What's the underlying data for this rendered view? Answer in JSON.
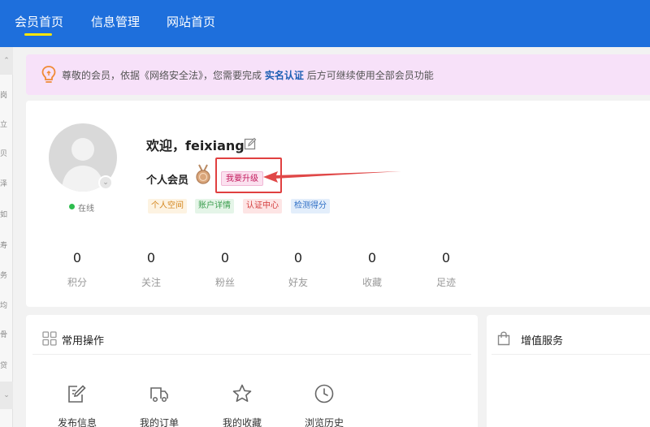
{
  "top_nav": {
    "items": [
      {
        "label": "会员首页",
        "active": true
      },
      {
        "label": "信息管理",
        "active": false
      },
      {
        "label": "网站首页",
        "active": false
      }
    ],
    "accent_color": "#ffe600",
    "background_color": "#1e6fdc"
  },
  "sidebar": {
    "chars": [
      "岗",
      "立",
      "贝",
      "泽",
      "如",
      "寿",
      "务",
      "均",
      "骨",
      "贷"
    ]
  },
  "notice": {
    "prefix": "尊敬的会员，依据《网络安全法》，您需要完成",
    "link": "实名认证",
    "suffix": "后方可继续使用全部会员功能",
    "icon": "lightbulb-icon"
  },
  "profile": {
    "welcome": "欢迎，feixiang",
    "status": "在线",
    "member_level": "个人会员",
    "upgrade_label": "我要升级",
    "tags": [
      "个人空间",
      "账户详情",
      "认证中心",
      "检测得分"
    ],
    "stats": [
      {
        "value": "0",
        "label": "积分"
      },
      {
        "value": "0",
        "label": "关注"
      },
      {
        "value": "0",
        "label": "粉丝"
      },
      {
        "value": "0",
        "label": "好友"
      },
      {
        "value": "0",
        "label": "收藏"
      },
      {
        "value": "0",
        "label": "足迹"
      }
    ]
  },
  "common_ops": {
    "title": "常用操作",
    "items": [
      {
        "label": "发布信息",
        "icon": "edit-doc-icon"
      },
      {
        "label": "我的订单",
        "icon": "truck-icon"
      },
      {
        "label": "我的收藏",
        "icon": "star-icon"
      },
      {
        "label": "浏览历史",
        "icon": "clock-icon"
      }
    ]
  },
  "value_added": {
    "title": "增值服务",
    "icon": "shopping-bag-icon"
  }
}
